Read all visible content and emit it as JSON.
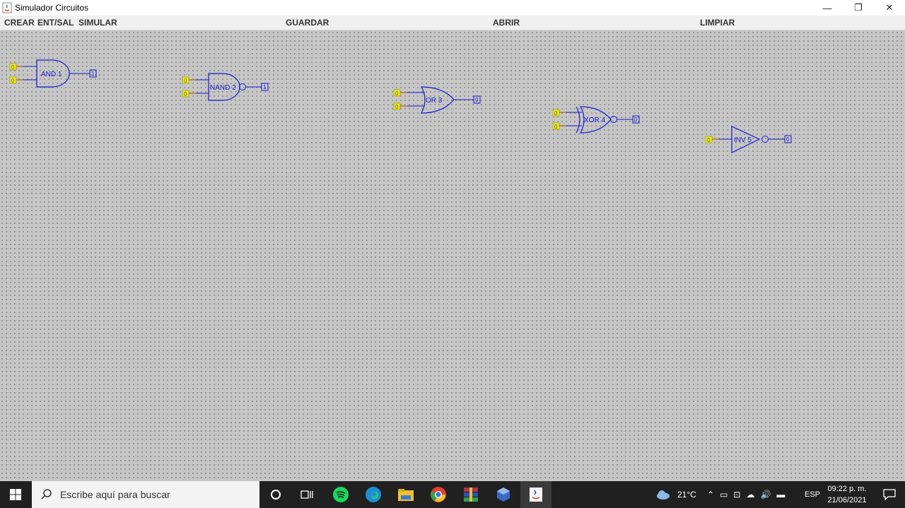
{
  "window": {
    "title": "Simulador Circuitos",
    "controls": {
      "minimize": "—",
      "restore": "❐",
      "close": "✕"
    }
  },
  "menu": {
    "crear": "CREAR",
    "entsal": "ENT/SAL",
    "simular": "SIMULAR",
    "guardar": "GUARDAR",
    "abrir": "ABRIR",
    "limpiar": "LIMPIAR"
  },
  "gates": [
    {
      "type": "AND",
      "label": "AND 1",
      "output": "1",
      "inputs": [
        "0",
        "0"
      ]
    },
    {
      "type": "NAND",
      "label": "NAND 2",
      "output": "1",
      "inputs": [
        "0",
        "0"
      ]
    },
    {
      "type": "OR",
      "label": "OR 3",
      "output": "0",
      "inputs": [
        "0",
        "0"
      ]
    },
    {
      "type": "XNOR",
      "label": "XOR 4",
      "output": "0",
      "inputs": [
        "0",
        "0"
      ]
    },
    {
      "type": "NOT",
      "label": "INV 5",
      "output": "0",
      "inputs": [
        "0"
      ]
    }
  ],
  "taskbar": {
    "search_placeholder": "Escribe aquí para buscar",
    "weather": "21°C",
    "language": "ESP",
    "time": "09:22 p. m.",
    "date": "21/06/2021"
  },
  "colors": {
    "gate": "#1a1ad0",
    "input_pin": "#e8e840",
    "input_wire": "#c07030",
    "canvas": "#c6c6c6"
  }
}
